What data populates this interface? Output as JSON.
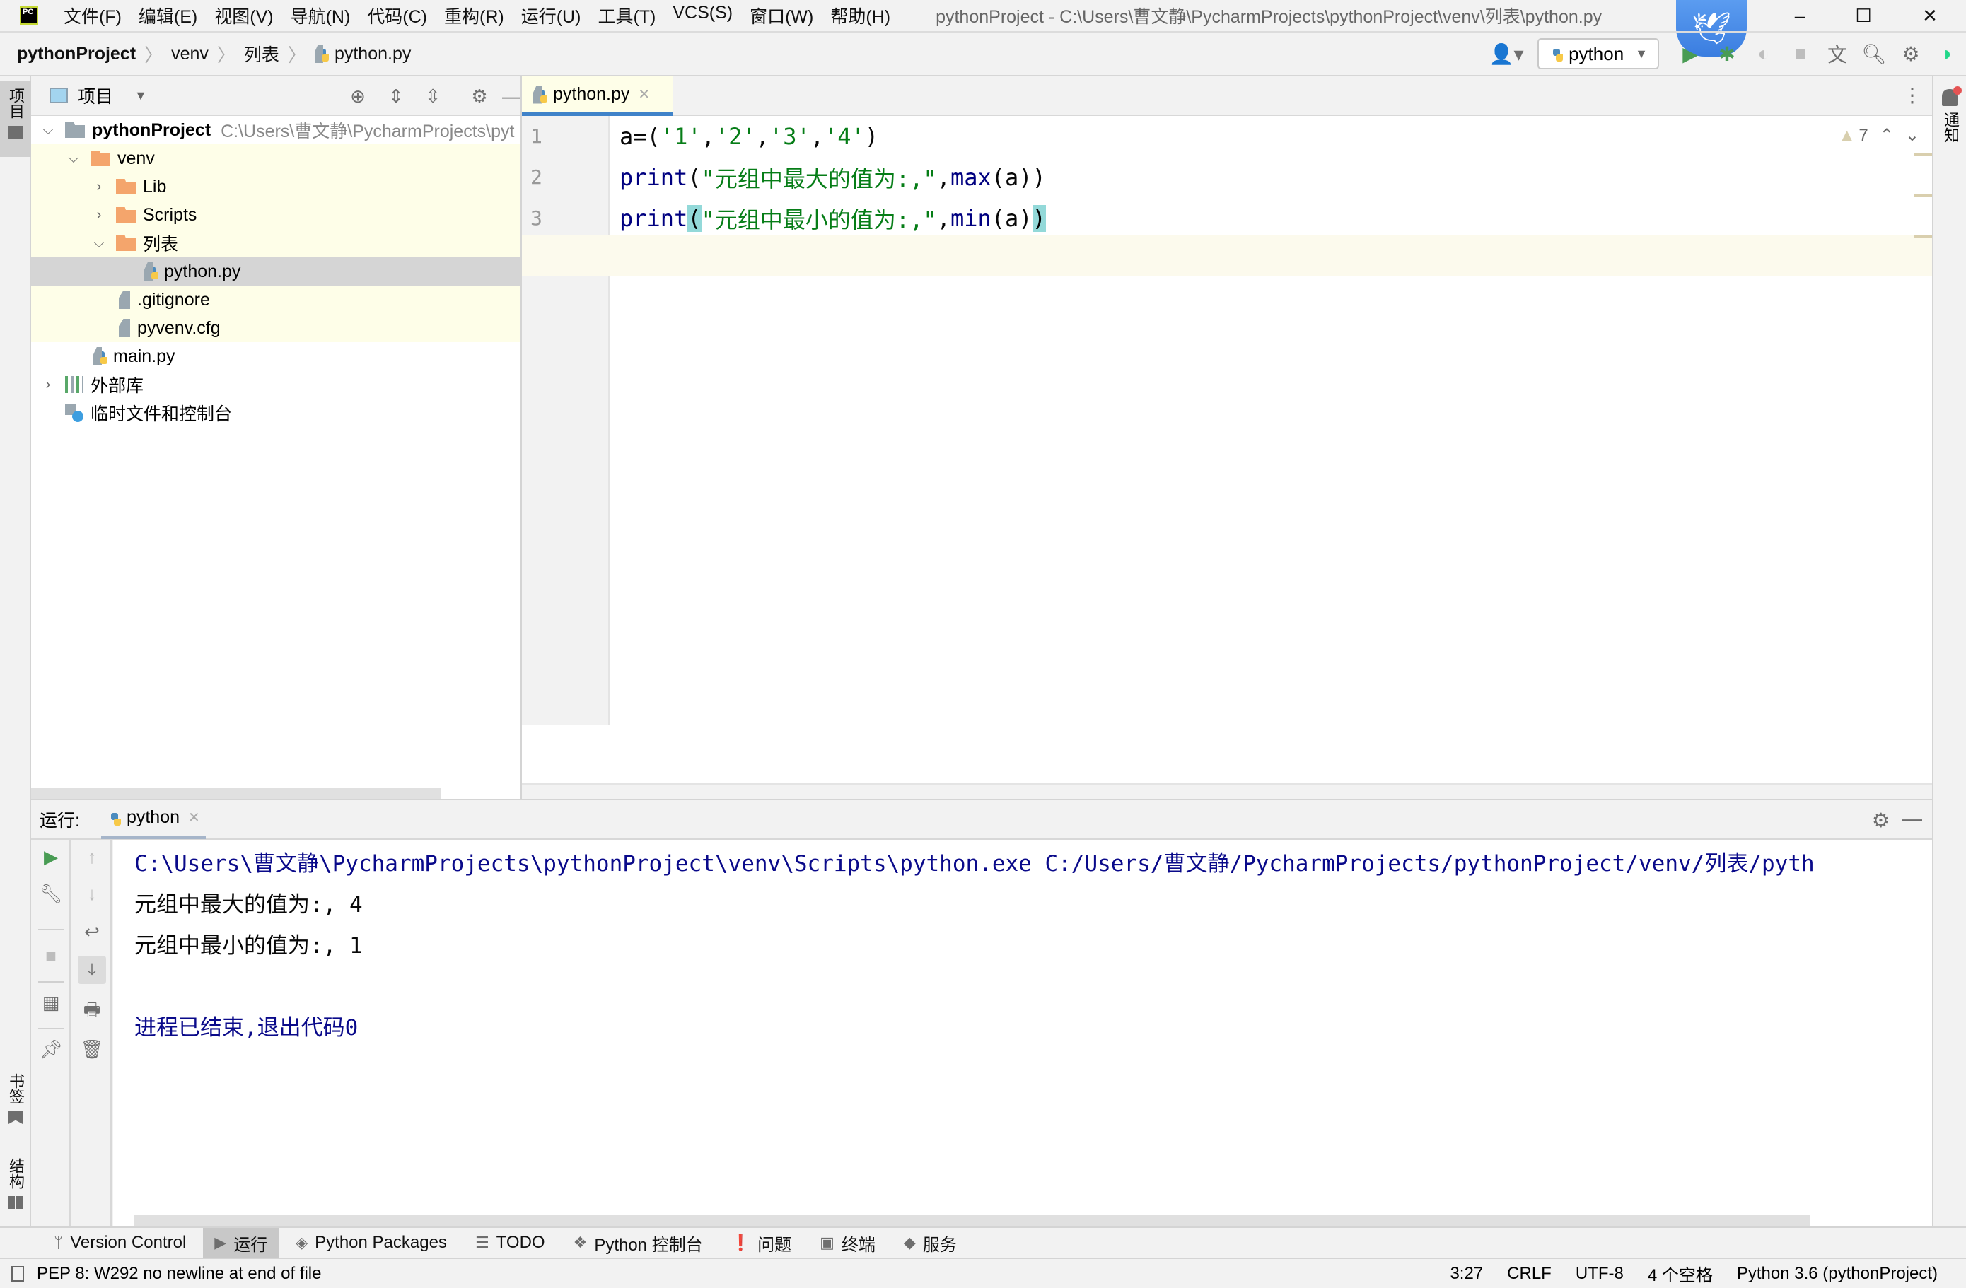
{
  "titlebar": {
    "logo": "PC",
    "menu": [
      "文件(F)",
      "编辑(E)",
      "视图(V)",
      "导航(N)",
      "代码(C)",
      "重构(R)",
      "运行(U)",
      "工具(T)",
      "VCS(S)",
      "窗口(W)",
      "帮助(H)"
    ],
    "window_title": "pythonProject - C:\\Users\\曹文静\\PycharmProjects\\pythonProject\\venv\\列表\\python.py",
    "controls": {
      "minimize": "–",
      "maximize": "☐",
      "close": "✕"
    }
  },
  "navbar": {
    "breadcrumbs": [
      "pythonProject",
      "venv",
      "列表",
      "python.py"
    ],
    "run_config": "python",
    "icons": [
      "user-icon",
      "run-icon",
      "debug-icon",
      "coverage-icon",
      "stop-icon",
      "translate-icon",
      "search-icon",
      "settings-icon",
      "toolbox-icon"
    ]
  },
  "left_stripe": {
    "project": "项目",
    "bookmarks": "书签",
    "structure": "结构"
  },
  "right_stripe": {
    "notifications": "通知"
  },
  "project_panel": {
    "title": "项目",
    "tree": [
      {
        "label": "pythonProject",
        "path": "C:\\Users\\曹文静\\PycharmProjects\\pyt",
        "type": "project-root",
        "expanded": true
      },
      {
        "label": "venv",
        "type": "folder",
        "expanded": true
      },
      {
        "label": "Lib",
        "type": "folder",
        "expanded": false
      },
      {
        "label": "Scripts",
        "type": "folder",
        "expanded": false
      },
      {
        "label": "列表",
        "type": "folder",
        "expanded": true
      },
      {
        "label": "python.py",
        "type": "python-file",
        "selected": true
      },
      {
        "label": ".gitignore",
        "type": "ignore-file"
      },
      {
        "label": "pyvenv.cfg",
        "type": "config-file"
      },
      {
        "label": "main.py",
        "type": "python-file"
      },
      {
        "label": "外部库",
        "type": "libraries",
        "expanded": false
      },
      {
        "label": "临时文件和控制台",
        "type": "scratches"
      }
    ]
  },
  "editor": {
    "tab": "python.py",
    "warnings": "7",
    "lines": [
      {
        "no": "1",
        "tokens": [
          [
            "plain",
            "a=("
          ],
          [
            "str",
            "'1'"
          ],
          [
            "plain",
            ","
          ],
          [
            "str",
            "'2'"
          ],
          [
            "plain",
            ","
          ],
          [
            "str",
            "'3'"
          ],
          [
            "plain",
            ","
          ],
          [
            "str",
            "'4'"
          ],
          [
            "plain",
            ")"
          ]
        ]
      },
      {
        "no": "2",
        "tokens": [
          [
            "kw",
            "print"
          ],
          [
            "plain",
            "("
          ],
          [
            "str",
            "\"元组中最大的值为:,\""
          ],
          [
            "plain",
            ","
          ],
          [
            "kw",
            "max"
          ],
          [
            "plain",
            "(a))"
          ]
        ]
      },
      {
        "no": "3",
        "tokens": [
          [
            "kw",
            "print"
          ],
          [
            "brace",
            "("
          ],
          [
            "str",
            "\"元组中最小的值为:,\""
          ],
          [
            "plain",
            ","
          ],
          [
            "kw",
            "min"
          ],
          [
            "plain",
            "(a)"
          ],
          [
            "brace",
            ")"
          ]
        ]
      }
    ]
  },
  "run_panel": {
    "label": "运行:",
    "tab": "python",
    "console": {
      "command": "C:\\Users\\曹文静\\PycharmProjects\\pythonProject\\venv\\Scripts\\python.exe C:/Users/曹文静/PycharmProjects/pythonProject/venv/列表/pyth",
      "output": [
        "元组中最大的值为:, 4",
        "元组中最小的值为:, 1"
      ],
      "exit": "进程已结束,退出代码0"
    }
  },
  "tool_tabs": [
    {
      "label": "Version Control",
      "icon": "branch-icon"
    },
    {
      "label": "运行",
      "icon": "run-icon",
      "active": true
    },
    {
      "label": "Python Packages",
      "icon": "packages-icon"
    },
    {
      "label": "TODO",
      "icon": "todo-icon"
    },
    {
      "label": "Python 控制台",
      "icon": "python-console-icon"
    },
    {
      "label": "问题",
      "icon": "problems-icon"
    },
    {
      "label": "终端",
      "icon": "terminal-icon"
    },
    {
      "label": "服务",
      "icon": "services-icon"
    }
  ],
  "statusbar": {
    "message": "PEP 8: W292 no newline at end of file",
    "position": "3:27",
    "line_ending": "CRLF",
    "encoding": "UTF-8",
    "indent": "4 个空格",
    "interpreter": "Python 3.6 (pythonProject)"
  }
}
